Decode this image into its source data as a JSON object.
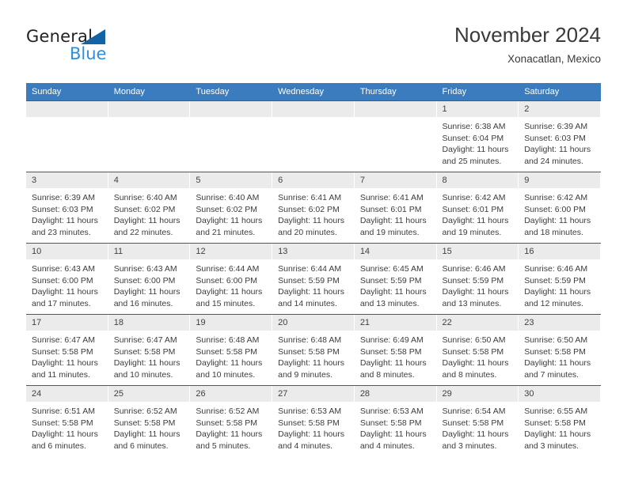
{
  "brand": {
    "name_part1": "General",
    "name_part2": "Blue"
  },
  "header": {
    "title": "November 2024",
    "subtitle": "Xonacatlan, Mexico"
  },
  "colors": {
    "header_blue": "#3a7cbe",
    "row_divider": "#2d5f96",
    "daynum_bg": "#ebebeb",
    "logo_blue": "#2f8ed6",
    "text": "#3c3c3c"
  },
  "weekdays": [
    "Sunday",
    "Monday",
    "Tuesday",
    "Wednesday",
    "Thursday",
    "Friday",
    "Saturday"
  ],
  "weeks": [
    [
      {
        "day": "",
        "sunrise": "",
        "sunset": "",
        "daylight1": "",
        "daylight2": ""
      },
      {
        "day": "",
        "sunrise": "",
        "sunset": "",
        "daylight1": "",
        "daylight2": ""
      },
      {
        "day": "",
        "sunrise": "",
        "sunset": "",
        "daylight1": "",
        "daylight2": ""
      },
      {
        "day": "",
        "sunrise": "",
        "sunset": "",
        "daylight1": "",
        "daylight2": ""
      },
      {
        "day": "",
        "sunrise": "",
        "sunset": "",
        "daylight1": "",
        "daylight2": ""
      },
      {
        "day": "1",
        "sunrise": "Sunrise: 6:38 AM",
        "sunset": "Sunset: 6:04 PM",
        "daylight1": "Daylight: 11 hours",
        "daylight2": "and 25 minutes."
      },
      {
        "day": "2",
        "sunrise": "Sunrise: 6:39 AM",
        "sunset": "Sunset: 6:03 PM",
        "daylight1": "Daylight: 11 hours",
        "daylight2": "and 24 minutes."
      }
    ],
    [
      {
        "day": "3",
        "sunrise": "Sunrise: 6:39 AM",
        "sunset": "Sunset: 6:03 PM",
        "daylight1": "Daylight: 11 hours",
        "daylight2": "and 23 minutes."
      },
      {
        "day": "4",
        "sunrise": "Sunrise: 6:40 AM",
        "sunset": "Sunset: 6:02 PM",
        "daylight1": "Daylight: 11 hours",
        "daylight2": "and 22 minutes."
      },
      {
        "day": "5",
        "sunrise": "Sunrise: 6:40 AM",
        "sunset": "Sunset: 6:02 PM",
        "daylight1": "Daylight: 11 hours",
        "daylight2": "and 21 minutes."
      },
      {
        "day": "6",
        "sunrise": "Sunrise: 6:41 AM",
        "sunset": "Sunset: 6:02 PM",
        "daylight1": "Daylight: 11 hours",
        "daylight2": "and 20 minutes."
      },
      {
        "day": "7",
        "sunrise": "Sunrise: 6:41 AM",
        "sunset": "Sunset: 6:01 PM",
        "daylight1": "Daylight: 11 hours",
        "daylight2": "and 19 minutes."
      },
      {
        "day": "8",
        "sunrise": "Sunrise: 6:42 AM",
        "sunset": "Sunset: 6:01 PM",
        "daylight1": "Daylight: 11 hours",
        "daylight2": "and 19 minutes."
      },
      {
        "day": "9",
        "sunrise": "Sunrise: 6:42 AM",
        "sunset": "Sunset: 6:00 PM",
        "daylight1": "Daylight: 11 hours",
        "daylight2": "and 18 minutes."
      }
    ],
    [
      {
        "day": "10",
        "sunrise": "Sunrise: 6:43 AM",
        "sunset": "Sunset: 6:00 PM",
        "daylight1": "Daylight: 11 hours",
        "daylight2": "and 17 minutes."
      },
      {
        "day": "11",
        "sunrise": "Sunrise: 6:43 AM",
        "sunset": "Sunset: 6:00 PM",
        "daylight1": "Daylight: 11 hours",
        "daylight2": "and 16 minutes."
      },
      {
        "day": "12",
        "sunrise": "Sunrise: 6:44 AM",
        "sunset": "Sunset: 6:00 PM",
        "daylight1": "Daylight: 11 hours",
        "daylight2": "and 15 minutes."
      },
      {
        "day": "13",
        "sunrise": "Sunrise: 6:44 AM",
        "sunset": "Sunset: 5:59 PM",
        "daylight1": "Daylight: 11 hours",
        "daylight2": "and 14 minutes."
      },
      {
        "day": "14",
        "sunrise": "Sunrise: 6:45 AM",
        "sunset": "Sunset: 5:59 PM",
        "daylight1": "Daylight: 11 hours",
        "daylight2": "and 13 minutes."
      },
      {
        "day": "15",
        "sunrise": "Sunrise: 6:46 AM",
        "sunset": "Sunset: 5:59 PM",
        "daylight1": "Daylight: 11 hours",
        "daylight2": "and 13 minutes."
      },
      {
        "day": "16",
        "sunrise": "Sunrise: 6:46 AM",
        "sunset": "Sunset: 5:59 PM",
        "daylight1": "Daylight: 11 hours",
        "daylight2": "and 12 minutes."
      }
    ],
    [
      {
        "day": "17",
        "sunrise": "Sunrise: 6:47 AM",
        "sunset": "Sunset: 5:58 PM",
        "daylight1": "Daylight: 11 hours",
        "daylight2": "and 11 minutes."
      },
      {
        "day": "18",
        "sunrise": "Sunrise: 6:47 AM",
        "sunset": "Sunset: 5:58 PM",
        "daylight1": "Daylight: 11 hours",
        "daylight2": "and 10 minutes."
      },
      {
        "day": "19",
        "sunrise": "Sunrise: 6:48 AM",
        "sunset": "Sunset: 5:58 PM",
        "daylight1": "Daylight: 11 hours",
        "daylight2": "and 10 minutes."
      },
      {
        "day": "20",
        "sunrise": "Sunrise: 6:48 AM",
        "sunset": "Sunset: 5:58 PM",
        "daylight1": "Daylight: 11 hours",
        "daylight2": "and 9 minutes."
      },
      {
        "day": "21",
        "sunrise": "Sunrise: 6:49 AM",
        "sunset": "Sunset: 5:58 PM",
        "daylight1": "Daylight: 11 hours",
        "daylight2": "and 8 minutes."
      },
      {
        "day": "22",
        "sunrise": "Sunrise: 6:50 AM",
        "sunset": "Sunset: 5:58 PM",
        "daylight1": "Daylight: 11 hours",
        "daylight2": "and 8 minutes."
      },
      {
        "day": "23",
        "sunrise": "Sunrise: 6:50 AM",
        "sunset": "Sunset: 5:58 PM",
        "daylight1": "Daylight: 11 hours",
        "daylight2": "and 7 minutes."
      }
    ],
    [
      {
        "day": "24",
        "sunrise": "Sunrise: 6:51 AM",
        "sunset": "Sunset: 5:58 PM",
        "daylight1": "Daylight: 11 hours",
        "daylight2": "and 6 minutes."
      },
      {
        "day": "25",
        "sunrise": "Sunrise: 6:52 AM",
        "sunset": "Sunset: 5:58 PM",
        "daylight1": "Daylight: 11 hours",
        "daylight2": "and 6 minutes."
      },
      {
        "day": "26",
        "sunrise": "Sunrise: 6:52 AM",
        "sunset": "Sunset: 5:58 PM",
        "daylight1": "Daylight: 11 hours",
        "daylight2": "and 5 minutes."
      },
      {
        "day": "27",
        "sunrise": "Sunrise: 6:53 AM",
        "sunset": "Sunset: 5:58 PM",
        "daylight1": "Daylight: 11 hours",
        "daylight2": "and 4 minutes."
      },
      {
        "day": "28",
        "sunrise": "Sunrise: 6:53 AM",
        "sunset": "Sunset: 5:58 PM",
        "daylight1": "Daylight: 11 hours",
        "daylight2": "and 4 minutes."
      },
      {
        "day": "29",
        "sunrise": "Sunrise: 6:54 AM",
        "sunset": "Sunset: 5:58 PM",
        "daylight1": "Daylight: 11 hours",
        "daylight2": "and 3 minutes."
      },
      {
        "day": "30",
        "sunrise": "Sunrise: 6:55 AM",
        "sunset": "Sunset: 5:58 PM",
        "daylight1": "Daylight: 11 hours",
        "daylight2": "and 3 minutes."
      }
    ]
  ]
}
